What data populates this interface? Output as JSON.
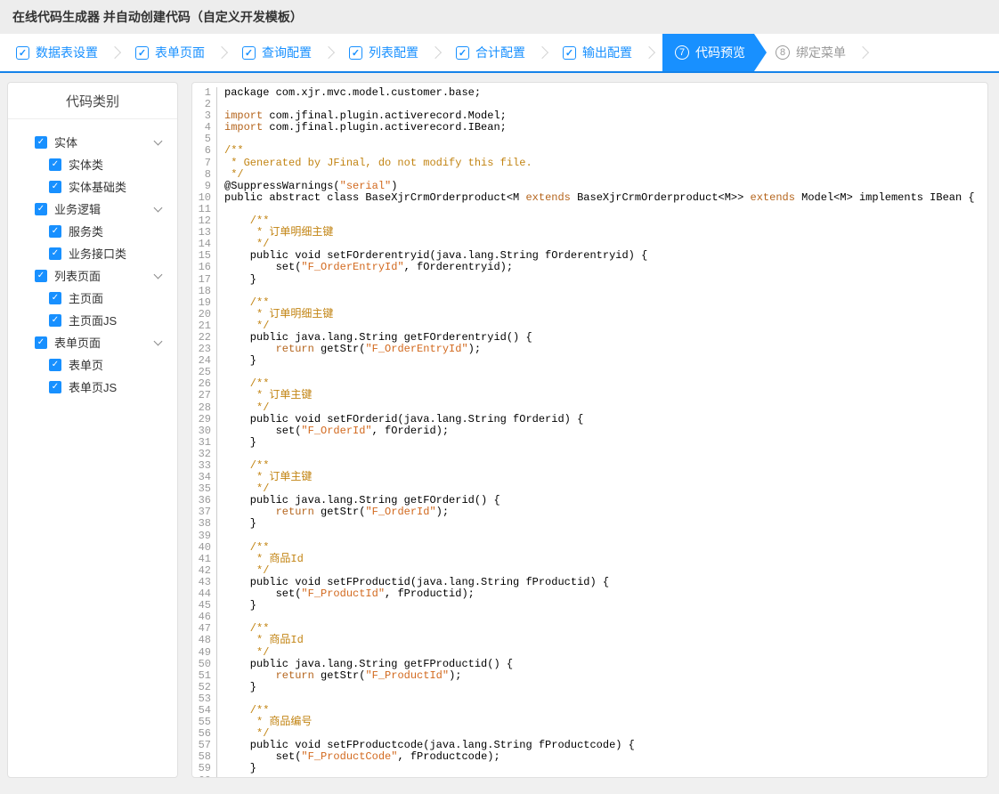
{
  "header": {
    "title": "在线代码生成器 并自动创建代码（自定义开发模板）"
  },
  "accent_color": "#1890ff",
  "steps": [
    {
      "label": "数据表设置",
      "state": "done"
    },
    {
      "label": "表单页面",
      "state": "done"
    },
    {
      "label": "查询配置",
      "state": "done"
    },
    {
      "label": "列表配置",
      "state": "done"
    },
    {
      "label": "合计配置",
      "state": "done"
    },
    {
      "label": "输出配置",
      "state": "done"
    },
    {
      "label": "代码预览",
      "state": "active",
      "number": "7"
    },
    {
      "label": "绑定菜单",
      "state": "pending",
      "number": "8"
    }
  ],
  "sidebar": {
    "title": "代码类别",
    "tree": [
      {
        "label": "实体",
        "checked": true,
        "expanded": true,
        "children": [
          "实体类",
          "实体基础类"
        ]
      },
      {
        "label": "业务逻辑",
        "checked": true,
        "expanded": true,
        "children": [
          "服务类",
          "业务接口类"
        ]
      },
      {
        "label": "列表页面",
        "checked": true,
        "expanded": true,
        "children": [
          "主页面",
          "主页面JS"
        ]
      },
      {
        "label": "表单页面",
        "checked": true,
        "expanded": true,
        "children": [
          "表单页",
          "表单页JS"
        ]
      }
    ]
  },
  "editor": {
    "language": "java",
    "lines": [
      [
        [
          "p",
          "package com.xjr.mvc.model.customer.base;"
        ]
      ],
      [],
      [
        [
          "k",
          "import"
        ],
        [
          "p",
          " com.jfinal.plugin.activerecord.Model;"
        ]
      ],
      [
        [
          "k",
          "import"
        ],
        [
          "p",
          " com.jfinal.plugin.activerecord.IBean;"
        ]
      ],
      [],
      [
        [
          "c",
          "/**"
        ]
      ],
      [
        [
          "c",
          " * Generated by JFinal, do not modify this file."
        ]
      ],
      [
        [
          "c",
          " */"
        ]
      ],
      [
        [
          "p",
          "@SuppressWarnings("
        ],
        [
          "s",
          "\"serial\""
        ],
        [
          "p",
          ")"
        ]
      ],
      [
        [
          "p",
          "public abstract class BaseXjrCrmOrderproduct<M "
        ],
        [
          "k",
          "extends"
        ],
        [
          "p",
          " BaseXjrCrmOrderproduct<M>> "
        ],
        [
          "k",
          "extends"
        ],
        [
          "p",
          " Model<M> implements IBean {"
        ]
      ],
      [],
      [
        [
          "c",
          "    /**"
        ]
      ],
      [
        [
          "c",
          "     * 订单明细主键"
        ]
      ],
      [
        [
          "c",
          "     */"
        ]
      ],
      [
        [
          "p",
          "    public void setFOrderentryid(java.lang.String fOrderentryid) {"
        ]
      ],
      [
        [
          "p",
          "        set("
        ],
        [
          "s",
          "\"F_OrderEntryId\""
        ],
        [
          "p",
          ", fOrderentryid);"
        ]
      ],
      [
        [
          "p",
          "    }"
        ]
      ],
      [],
      [
        [
          "c",
          "    /**"
        ]
      ],
      [
        [
          "c",
          "     * 订单明细主键"
        ]
      ],
      [
        [
          "c",
          "     */"
        ]
      ],
      [
        [
          "p",
          "    public java.lang.String getFOrderentryid() {"
        ]
      ],
      [
        [
          "p",
          "        "
        ],
        [
          "k",
          "return"
        ],
        [
          "p",
          " getStr("
        ],
        [
          "s",
          "\"F_OrderEntryId\""
        ],
        [
          "p",
          ");"
        ]
      ],
      [
        [
          "p",
          "    }"
        ]
      ],
      [],
      [
        [
          "c",
          "    /**"
        ]
      ],
      [
        [
          "c",
          "     * 订单主键"
        ]
      ],
      [
        [
          "c",
          "     */"
        ]
      ],
      [
        [
          "p",
          "    public void setFOrderid(java.lang.String fOrderid) {"
        ]
      ],
      [
        [
          "p",
          "        set("
        ],
        [
          "s",
          "\"F_OrderId\""
        ],
        [
          "p",
          ", fOrderid);"
        ]
      ],
      [
        [
          "p",
          "    }"
        ]
      ],
      [],
      [
        [
          "c",
          "    /**"
        ]
      ],
      [
        [
          "c",
          "     * 订单主键"
        ]
      ],
      [
        [
          "c",
          "     */"
        ]
      ],
      [
        [
          "p",
          "    public java.lang.String getFOrderid() {"
        ]
      ],
      [
        [
          "p",
          "        "
        ],
        [
          "k",
          "return"
        ],
        [
          "p",
          " getStr("
        ],
        [
          "s",
          "\"F_OrderId\""
        ],
        [
          "p",
          ");"
        ]
      ],
      [
        [
          "p",
          "    }"
        ]
      ],
      [],
      [
        [
          "c",
          "    /**"
        ]
      ],
      [
        [
          "c",
          "     * 商品Id"
        ]
      ],
      [
        [
          "c",
          "     */"
        ]
      ],
      [
        [
          "p",
          "    public void setFProductid(java.lang.String fProductid) {"
        ]
      ],
      [
        [
          "p",
          "        set("
        ],
        [
          "s",
          "\"F_ProductId\""
        ],
        [
          "p",
          ", fProductid);"
        ]
      ],
      [
        [
          "p",
          "    }"
        ]
      ],
      [],
      [
        [
          "c",
          "    /**"
        ]
      ],
      [
        [
          "c",
          "     * 商品Id"
        ]
      ],
      [
        [
          "c",
          "     */"
        ]
      ],
      [
        [
          "p",
          "    public java.lang.String getFProductid() {"
        ]
      ],
      [
        [
          "p",
          "        "
        ],
        [
          "k",
          "return"
        ],
        [
          "p",
          " getStr("
        ],
        [
          "s",
          "\"F_ProductId\""
        ],
        [
          "p",
          ");"
        ]
      ],
      [
        [
          "p",
          "    }"
        ]
      ],
      [],
      [
        [
          "c",
          "    /**"
        ]
      ],
      [
        [
          "c",
          "     * 商品编号"
        ]
      ],
      [
        [
          "c",
          "     */"
        ]
      ],
      [
        [
          "p",
          "    public void setFProductcode(java.lang.String fProductcode) {"
        ]
      ],
      [
        [
          "p",
          "        set("
        ],
        [
          "s",
          "\"F_ProductCode\""
        ],
        [
          "p",
          ", fProductcode);"
        ]
      ],
      [
        [
          "p",
          "    }"
        ]
      ],
      []
    ]
  }
}
